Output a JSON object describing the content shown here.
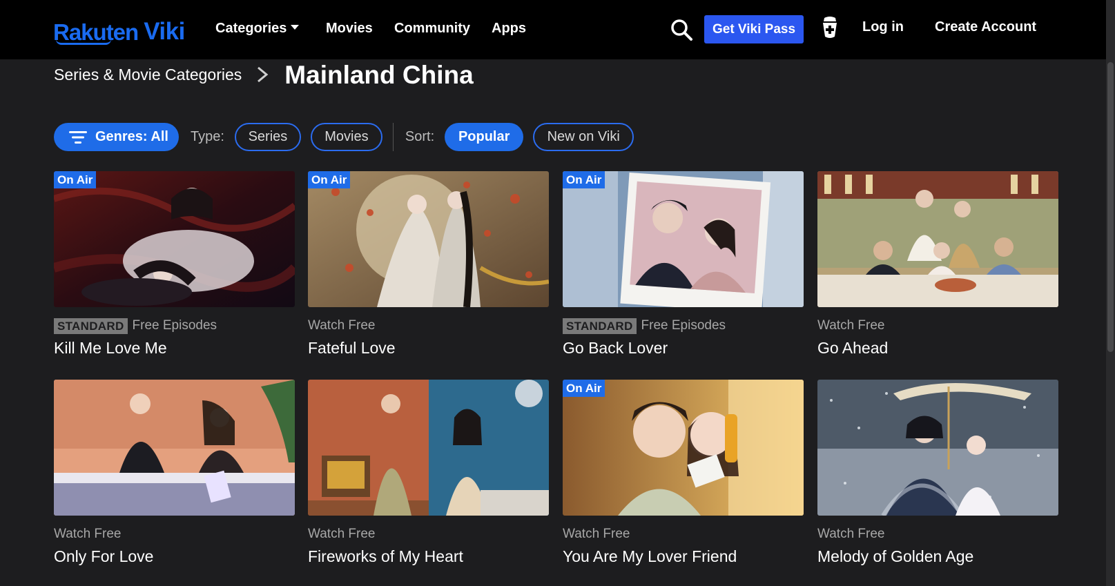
{
  "nav": {
    "logo_rakuten": "Rakuten",
    "logo_viki": "Viki",
    "categories": "Categories",
    "movies": "Movies",
    "community": "Community",
    "apps": "Apps",
    "viki_pass": "Get Viki Pass",
    "login": "Log in",
    "create_account": "Create Account",
    "icons": {
      "search": "search-icon",
      "cup": "cup-icon",
      "caret": "chevron-down-icon"
    }
  },
  "breadcrumb": {
    "parent": "Series & Movie Categories",
    "current": "Mainland China"
  },
  "filters": {
    "genres": "Genres: All",
    "type_label": "Type:",
    "type_options": [
      "Series",
      "Movies"
    ],
    "sort_label": "Sort:",
    "sort_options": [
      "Popular",
      "New on Viki"
    ],
    "selected_sort": "Popular"
  },
  "cards": [
    {
      "on_air": "On Air",
      "badge": "STANDARD",
      "meta": "Free Episodes",
      "title": "Kill Me Love Me"
    },
    {
      "on_air": "On Air",
      "badge": "",
      "meta": "Watch Free",
      "title": "Fateful Love"
    },
    {
      "on_air": "On Air",
      "badge": "STANDARD",
      "meta": "Free Episodes",
      "title": "Go Back Lover"
    },
    {
      "on_air": "",
      "badge": "",
      "meta": "Watch Free",
      "title": "Go Ahead"
    },
    {
      "on_air": "",
      "badge": "",
      "meta": "Watch Free",
      "title": "Only For Love"
    },
    {
      "on_air": "",
      "badge": "",
      "meta": "Watch Free",
      "title": "Fireworks of My Heart"
    },
    {
      "on_air": "On Air",
      "badge": "",
      "meta": "Watch Free",
      "title": "You Are My Lover Friend"
    },
    {
      "on_air": "",
      "badge": "",
      "meta": "Watch Free",
      "title": "Melody of Golden Age"
    }
  ],
  "colors": {
    "accent": "#1f6ce8",
    "nav_bg": "#000000",
    "page_bg": "#1d1d1f",
    "viki_pass": "#2b57f0"
  }
}
